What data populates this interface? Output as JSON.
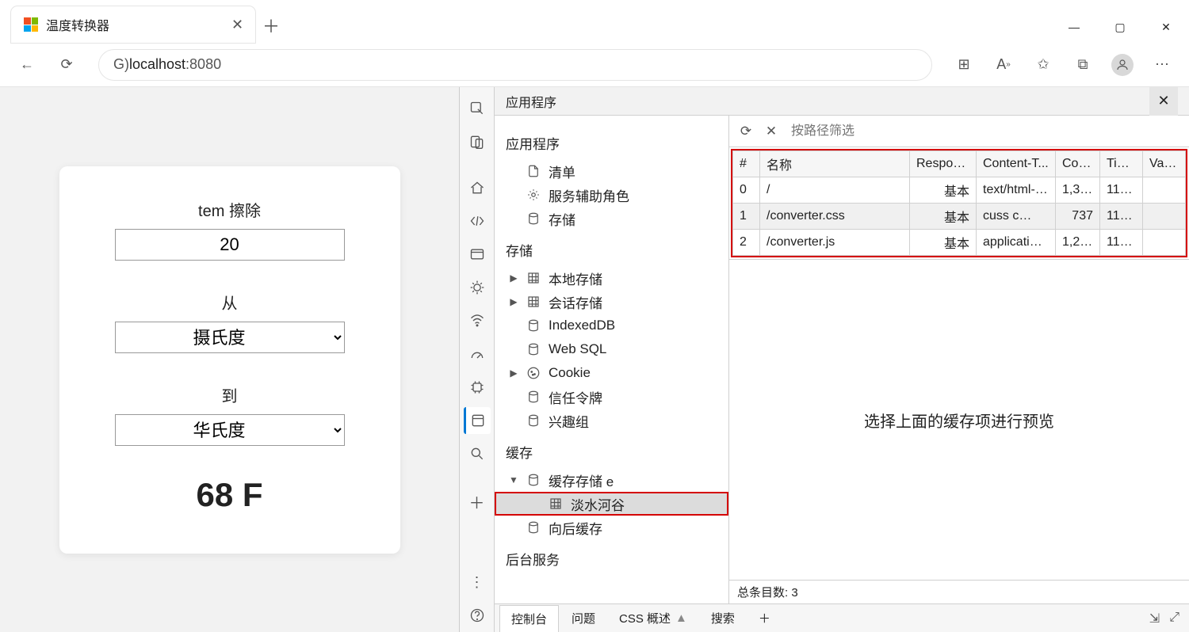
{
  "browser": {
    "tab_title": "温度转换器",
    "address_prefix": "G) ",
    "address_host": "localhost",
    "address_port": " :8080"
  },
  "page": {
    "input_label": "tem 擦除",
    "input_value": "20",
    "from_label": "从",
    "from_value": "摄氏度",
    "to_label": "到",
    "to_value": "华氏度",
    "result": "68 F"
  },
  "devtools": {
    "panel_title": "应用程序",
    "tree": {
      "s1": "应用程序",
      "s1_items": [
        "清单",
        "服务辅助角色",
        "存储"
      ],
      "s2": "存储",
      "s2_items": [
        "本地存储",
        "会话存储",
        "IndexedDB",
        "Web SQL",
        "Cookie",
        "信任令牌",
        "兴趣组"
      ],
      "s3": "缓存",
      "s3_items": [
        "缓存存储 e",
        "淡水河谷",
        "向后缓存"
      ],
      "s4": "后台服务"
    },
    "filter_placeholder": "按路径筛选",
    "columns": [
      "#",
      "名称",
      "Respons...",
      "Content-T...",
      "Con...",
      "Tim...",
      "Vary..."
    ],
    "rows": [
      {
        "idx": "0",
        "name": "/",
        "resp": "基本",
        "ct": "text/html- …",
        "len": "1,397",
        "time": "11/2..."
      },
      {
        "idx": "1",
        "name": "/converter.css",
        "resp": "基本",
        "ct": "cuss c…",
        "len": "737",
        "time": "11/2..."
      },
      {
        "idx": "2",
        "name": "/converter.js",
        "resp": "基本",
        "ct": "applicatio…",
        "len": "1,282",
        "time": "11/2..."
      }
    ],
    "preview_msg": "选择上面的缓存项进行预览",
    "status_label": "总条目数:",
    "status_count": "3",
    "drawer_tabs": [
      "控制台",
      "问题",
      "CSS 概述",
      "搜索"
    ]
  }
}
